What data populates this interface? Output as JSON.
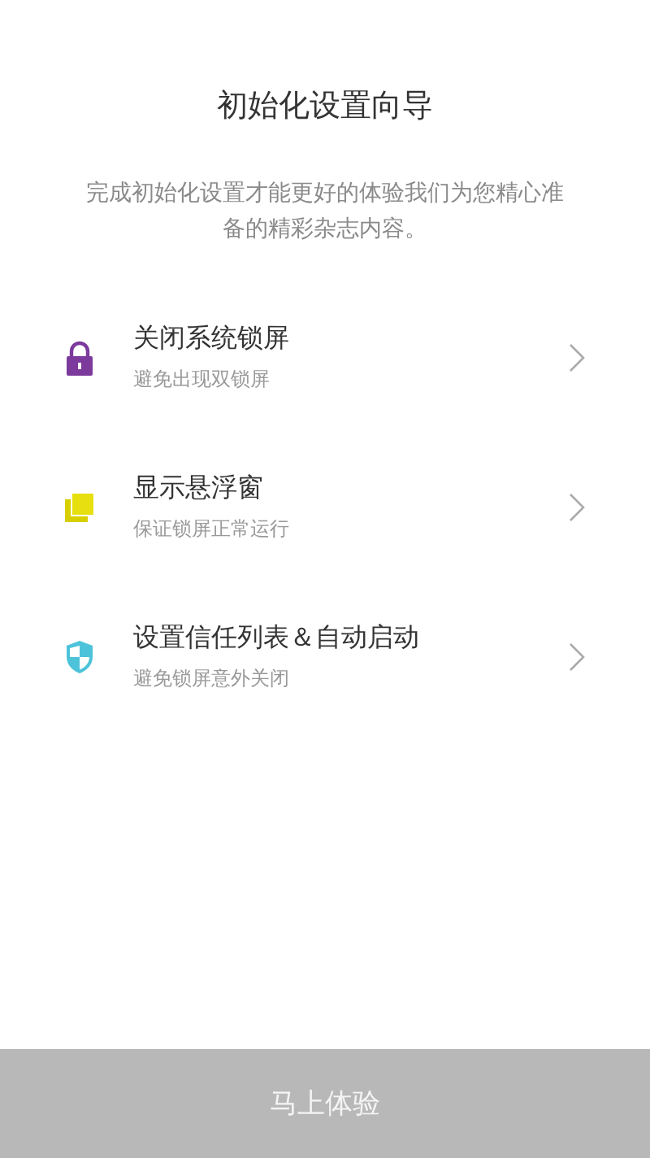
{
  "title": "初始化设置向导",
  "intro": "完成初始化设置才能更好的体验我们为您精心准备的精彩杂志内容。",
  "steps": [
    {
      "kind": "lock",
      "title": "关闭系统锁屏",
      "subtitle": "避免出现双锁屏"
    },
    {
      "kind": "windows",
      "title": "显示悬浮窗",
      "subtitle": "保证锁屏正常运行"
    },
    {
      "kind": "shield",
      "title": "设置信任列表＆自动启动",
      "subtitle": "避免锁屏意外关闭"
    }
  ],
  "button": "马上体验"
}
